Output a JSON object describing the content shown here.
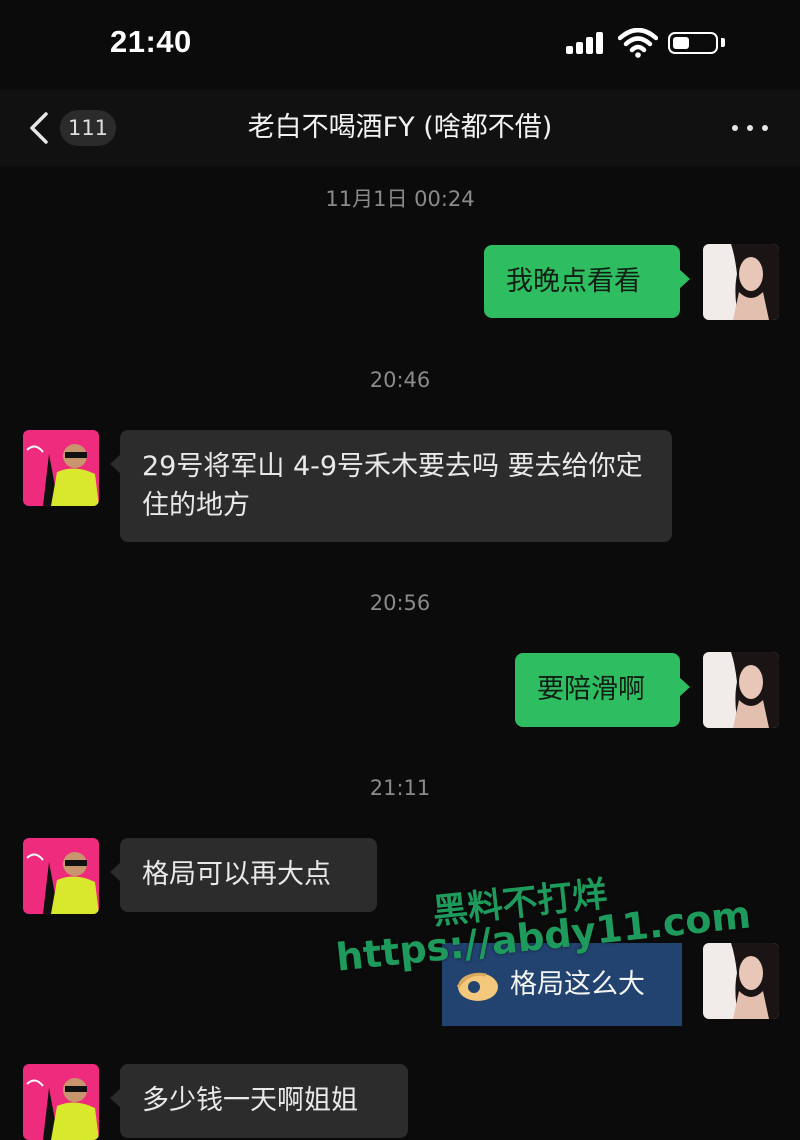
{
  "status_bar": {
    "time": "21:40"
  },
  "header": {
    "unread_count": "111",
    "title": "老白不喝酒FY (啥都不借)"
  },
  "messages": [
    {
      "type": "time",
      "text": "11月1日 00:24"
    },
    {
      "type": "sent",
      "text": "我晚点看看"
    },
    {
      "type": "time",
      "text": "20:46"
    },
    {
      "type": "received",
      "text": "29号将军山 4-9号禾木要去吗 要去给你定住的地方"
    },
    {
      "type": "time",
      "text": "20:56"
    },
    {
      "type": "sent",
      "text": "要陪滑啊"
    },
    {
      "type": "time",
      "text": "21:11"
    },
    {
      "type": "received",
      "text": "格局可以再大点"
    },
    {
      "type": "sent_sticker",
      "text": "格局这么大"
    },
    {
      "type": "received",
      "text": "多少钱一天啊姐姐"
    }
  ],
  "watermark": {
    "line1": "黑料不打烊",
    "line2": "https://abdy11.com"
  },
  "icons": {
    "back": "chevron-left-icon",
    "more": "more-dots-icon",
    "signal": "cellular-signal-icon",
    "wifi": "wifi-icon",
    "battery": "battery-icon",
    "sticker": "ok-hand-icon"
  },
  "colors": {
    "background": "#0b0b0b",
    "sent_bubble": "#2fbd62",
    "received_bubble": "#2c2c2c",
    "watermark": "#1e9a5c"
  }
}
